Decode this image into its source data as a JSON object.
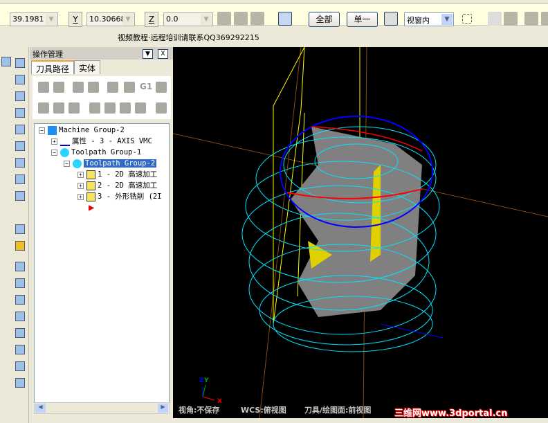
{
  "coords": {
    "x_value": "39.1981",
    "y_label": "Y",
    "y_value": "10.30668",
    "z_label": "Z",
    "z_value": "0.0"
  },
  "toolbar": {
    "all_button": "全部",
    "single_button": "单一",
    "view_select": "视窗内"
  },
  "info_text": "视频教程·远程培训请联系QQ369292215",
  "panel": {
    "title": "操作管理",
    "tabs": [
      "刀具路径",
      "实体"
    ],
    "g1_label": "G1"
  },
  "tree": {
    "machine_group": "Machine Group-2",
    "properties": "属性 - 3 - AXIS VMC",
    "toolpath_group_1": "Toolpath Group-1",
    "toolpath_group_2": "Toolpath Group-2",
    "operations": [
      "1 - 2D 高速加工",
      "2 - 2D 高速加工",
      "3 - 外形铣削 (2I"
    ]
  },
  "viewport": {
    "status": [
      "视角:不保存",
      "WCS:俯视图",
      "刀具/绘图面:前视图"
    ],
    "axis_labels": {
      "z": "Z",
      "y": "Y",
      "x": "X"
    },
    "watermark": "三维网www.3dportal.cn",
    "colors": {
      "background": "#000000",
      "toolpath": "#00e5ff",
      "part": "#808080",
      "highlight": "#ffff00",
      "circle": "#0000ff"
    }
  }
}
